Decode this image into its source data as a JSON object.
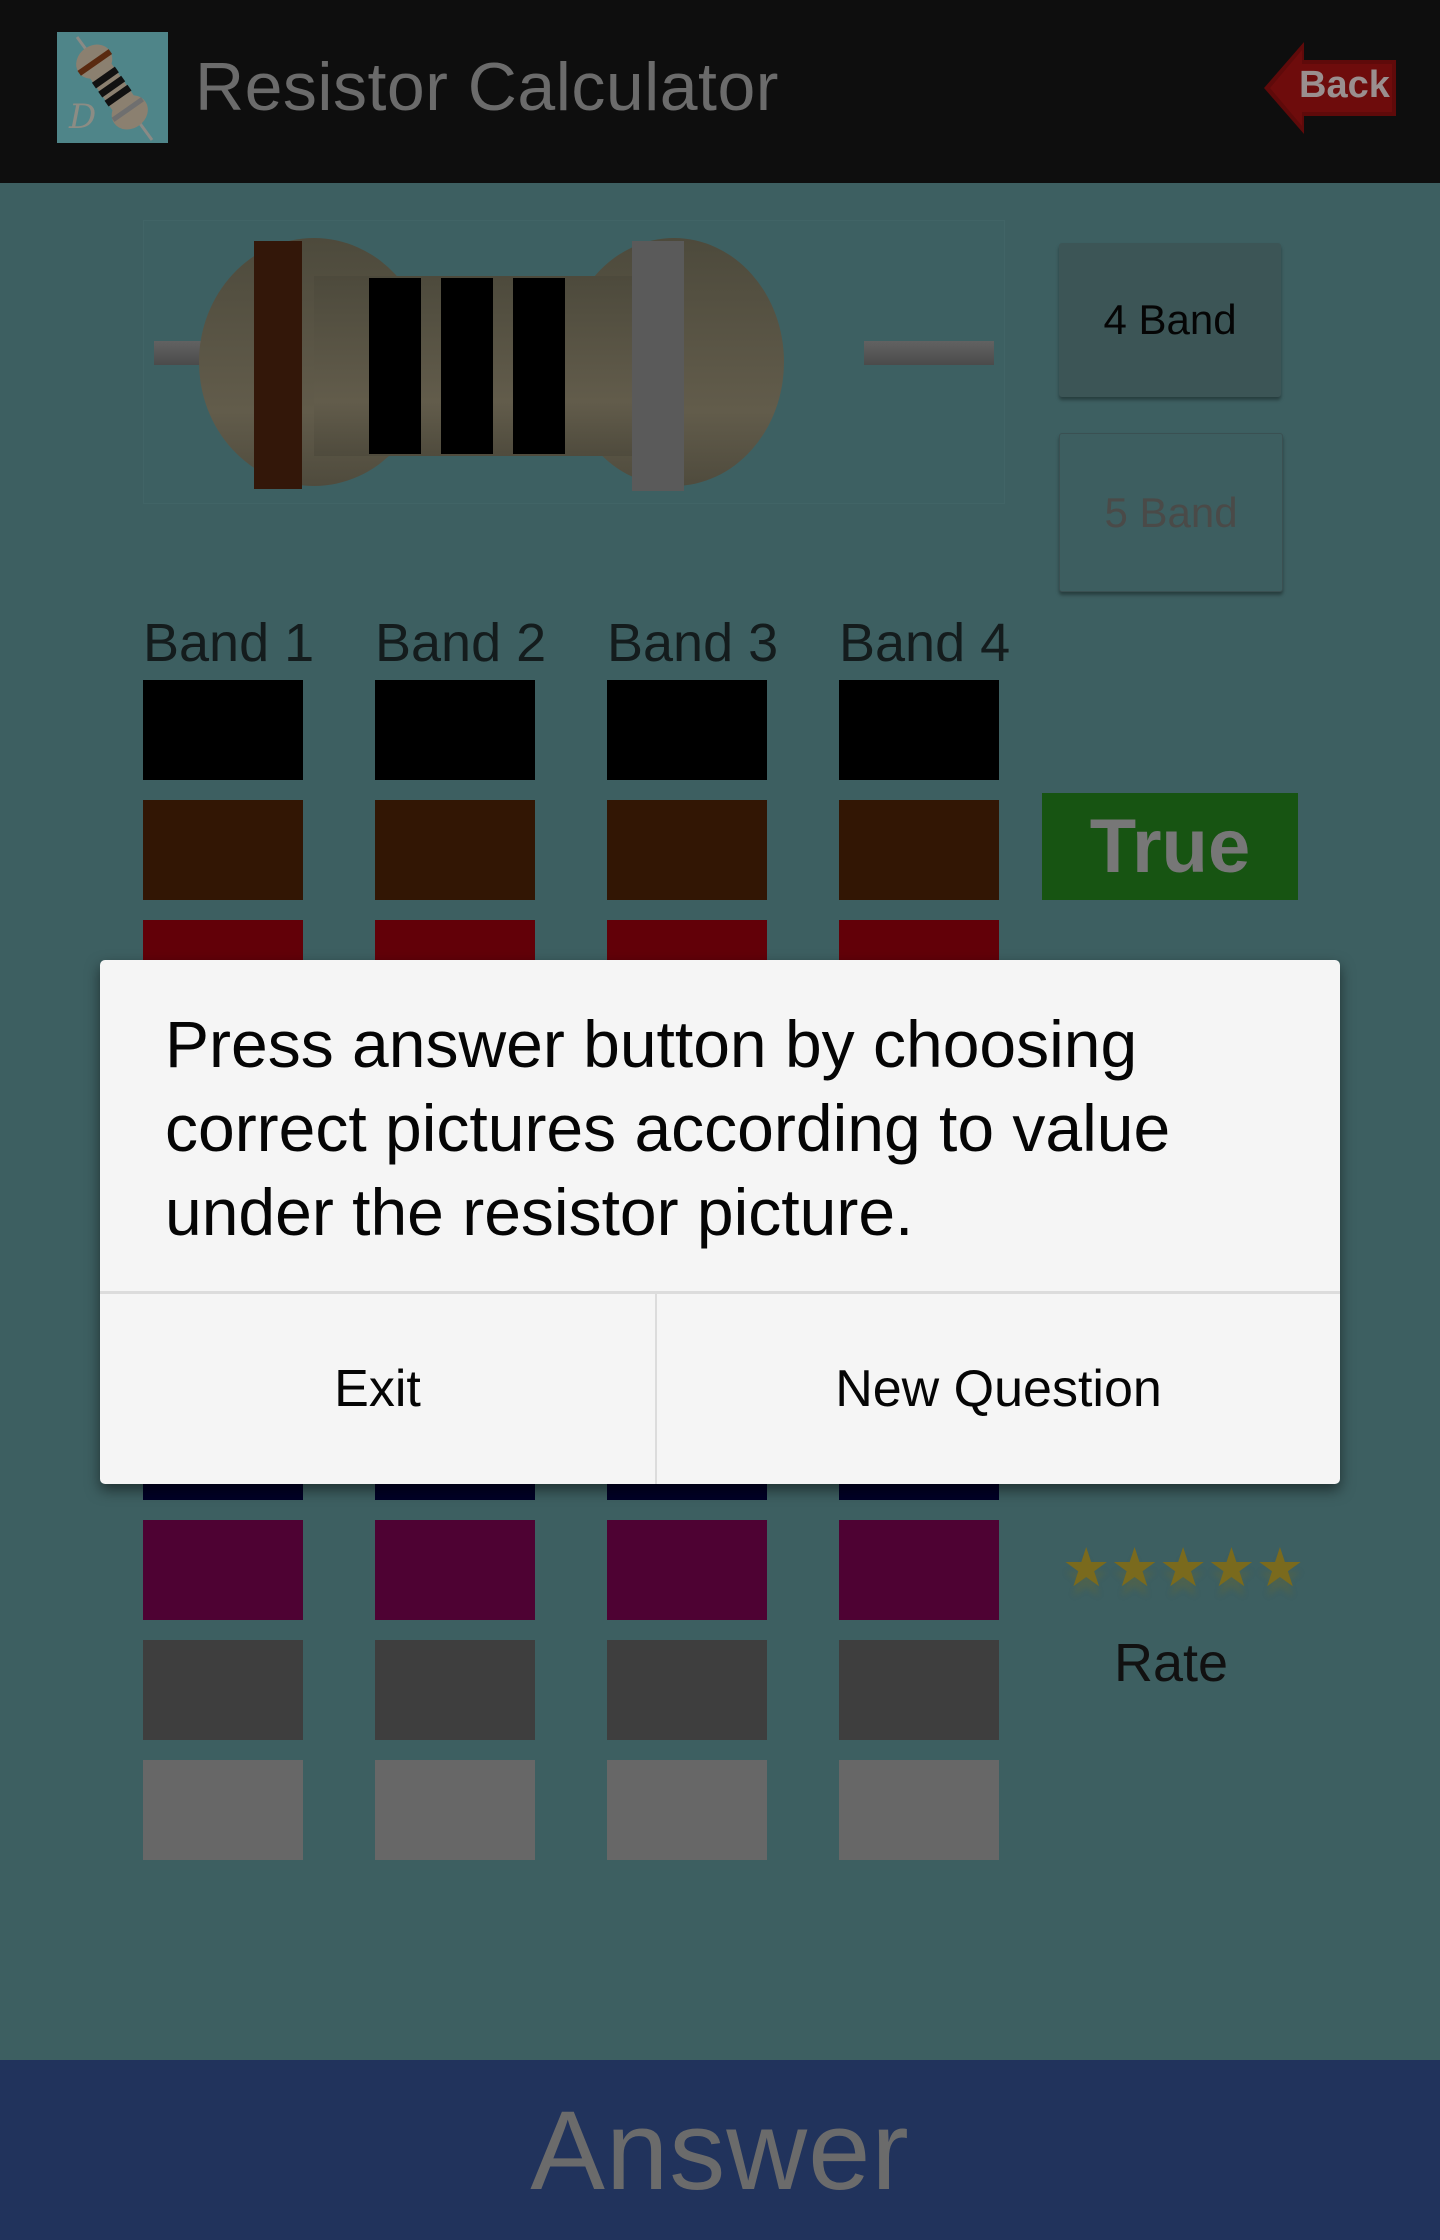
{
  "header": {
    "title": "Resistor Calculator",
    "app_icon": "resistor-logo-icon",
    "back_label": "Back"
  },
  "resistor": {
    "bands": [
      "#331709",
      "#000000",
      "#000000",
      "#000000",
      "#5a5a5a"
    ],
    "body_color": "#5f574a"
  },
  "band_mode": {
    "four_band_label": "4 Band",
    "five_band_label": "5 Band",
    "selected": "4 Band"
  },
  "band_columns": [
    {
      "label": "Band 1"
    },
    {
      "label": "Band 2"
    },
    {
      "label": "Band 3"
    },
    {
      "label": "Band 4"
    }
  ],
  "color_rows": [
    {
      "name": "black",
      "hex": "#000000"
    },
    {
      "name": "brown",
      "hex": "#321604"
    },
    {
      "name": "red",
      "hex": "#620008"
    },
    {
      "name": "orange",
      "hex": "#6a3a00"
    },
    {
      "name": "yellow",
      "hex": "#6a6a00"
    },
    {
      "name": "green",
      "hex": "#0a4a0a"
    },
    {
      "name": "blue",
      "hex": "#000026"
    },
    {
      "name": "violet",
      "hex": "#4e0233"
    },
    {
      "name": "gray",
      "hex": "#3e3e3e"
    },
    {
      "name": "white",
      "hex": "#676767"
    }
  ],
  "result_badge": {
    "label": "True",
    "color": "#175412"
  },
  "rating": {
    "stars": 5,
    "label": "Rate"
  },
  "dialog": {
    "message": "Press answer button by choosing correct pictures according to value under the resistor picture.",
    "exit_label": "Exit",
    "new_question_label": "New Question"
  },
  "answer_button": {
    "label": "Answer",
    "color": "#21335c"
  }
}
